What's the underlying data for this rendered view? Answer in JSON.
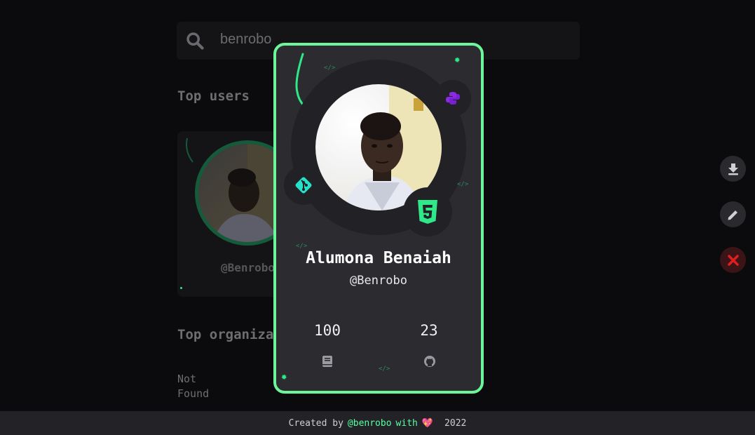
{
  "search": {
    "query": "benrobo"
  },
  "sections": {
    "top_users": "Top users",
    "top_orgs": "Top organiza",
    "not_found_line1": "Not",
    "not_found_line2": "Found"
  },
  "bg_user": {
    "handle": "@Benrobo"
  },
  "card": {
    "name": "Alumona Benaiah",
    "handle": "@Benrobo",
    "repos_count": "100",
    "github_count": "23",
    "accent_color": "#6cf59b",
    "badges": [
      "python-icon",
      "git-icon",
      "html5-icon"
    ]
  },
  "actions": [
    "download-icon",
    "edit-icon",
    "close-icon"
  ],
  "footer": {
    "created_by": "Created by",
    "author": "@benrobo",
    "with": "with",
    "heart": "💖",
    "year": "2022"
  }
}
